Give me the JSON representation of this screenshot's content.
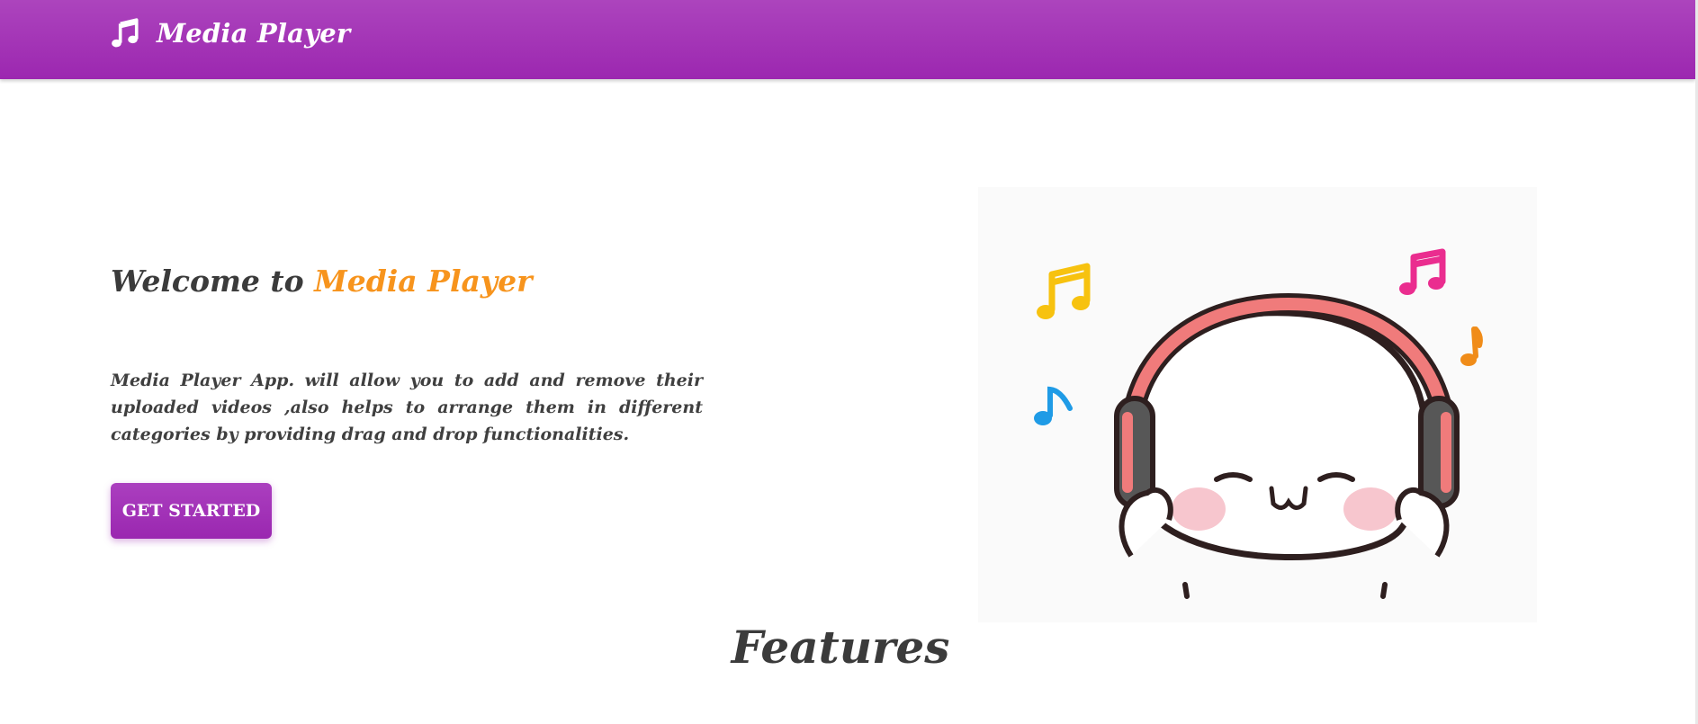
{
  "navbar": {
    "brand_icon": "music-note-icon",
    "brand_text": "Media Player",
    "color": "#9c27b0"
  },
  "hero": {
    "title_prefix": "Welcome to",
    "title_highlight": "Media Player",
    "highlight_color": "#f7941d",
    "description": "Media Player App. will allow you to add and remove their uploaded videos ,also helps to arrange them in different categories by providing drag and drop functionalities.",
    "cta_label": "GET STARTED",
    "illustration": "headphone-bear-illustration"
  },
  "features": {
    "title": "Features"
  }
}
